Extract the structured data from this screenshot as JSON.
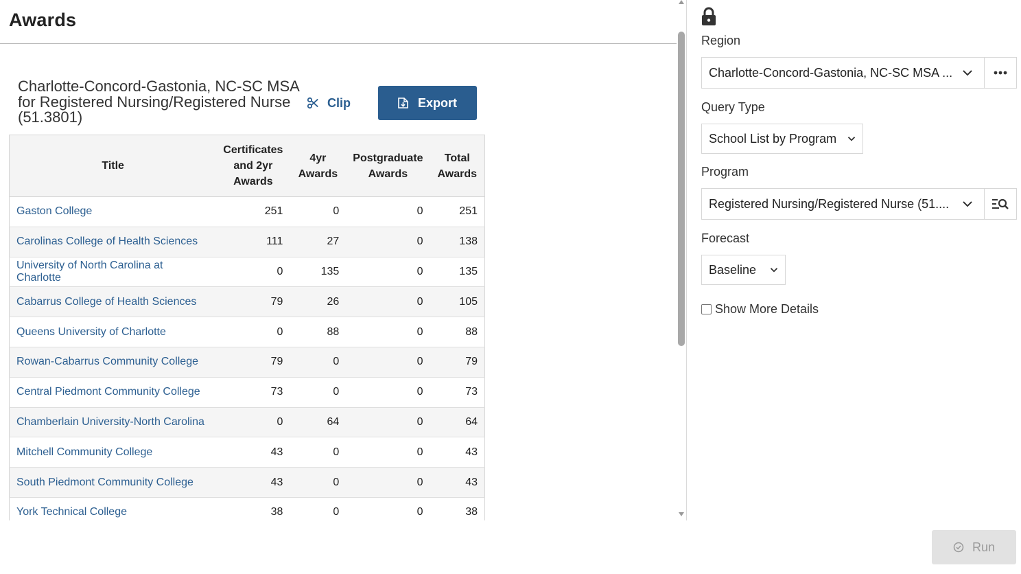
{
  "page": {
    "title": "Awards"
  },
  "report": {
    "heading": "Charlotte-Concord-Gastonia, NC-SC MSA for Registered Nursing/Registered Nurse (51.3801)",
    "clip_label": "Clip",
    "export_label": "Export"
  },
  "table": {
    "headers": {
      "title": "Title",
      "cert": "Certificates and 2yr Awards",
      "fouryr": "4yr Awards",
      "post": "Postgraduate Awards",
      "total": "Total Awards"
    },
    "rows": [
      {
        "title": "Gaston College",
        "cert": "251",
        "fouryr": "0",
        "post": "0",
        "total": "251"
      },
      {
        "title": "Carolinas College of Health Sciences",
        "cert": "111",
        "fouryr": "27",
        "post": "0",
        "total": "138"
      },
      {
        "title": "University of North Carolina at Charlotte",
        "cert": "0",
        "fouryr": "135",
        "post": "0",
        "total": "135"
      },
      {
        "title": "Cabarrus College of Health Sciences",
        "cert": "79",
        "fouryr": "26",
        "post": "0",
        "total": "105"
      },
      {
        "title": "Queens University of Charlotte",
        "cert": "0",
        "fouryr": "88",
        "post": "0",
        "total": "88"
      },
      {
        "title": "Rowan-Cabarrus Community College",
        "cert": "79",
        "fouryr": "0",
        "post": "0",
        "total": "79"
      },
      {
        "title": "Central Piedmont Community College",
        "cert": "73",
        "fouryr": "0",
        "post": "0",
        "total": "73"
      },
      {
        "title": "Chamberlain University-North Carolina",
        "cert": "0",
        "fouryr": "64",
        "post": "0",
        "total": "64"
      },
      {
        "title": "Mitchell Community College",
        "cert": "43",
        "fouryr": "0",
        "post": "0",
        "total": "43"
      },
      {
        "title": "South Piedmont Community College",
        "cert": "43",
        "fouryr": "0",
        "post": "0",
        "total": "43"
      },
      {
        "title": "York Technical College",
        "cert": "38",
        "fouryr": "0",
        "post": "0",
        "total": "38"
      }
    ]
  },
  "sidebar": {
    "region": {
      "label": "Region",
      "value": "Charlotte-Concord-Gastonia, NC-SC MSA ..."
    },
    "query_type": {
      "label": "Query Type",
      "value": "School List by Program"
    },
    "program": {
      "label": "Program",
      "value": "Registered Nursing/Registered Nurse (51...."
    },
    "forecast": {
      "label": "Forecast",
      "value": "Baseline"
    },
    "show_more": {
      "label": "Show More Details",
      "checked": false
    },
    "run_label": "Run"
  },
  "colors": {
    "accent": "#2a5d8f",
    "link": "#2c5f91",
    "disabled_bg": "#e2e2e2",
    "disabled_text": "#9a9a9a"
  }
}
